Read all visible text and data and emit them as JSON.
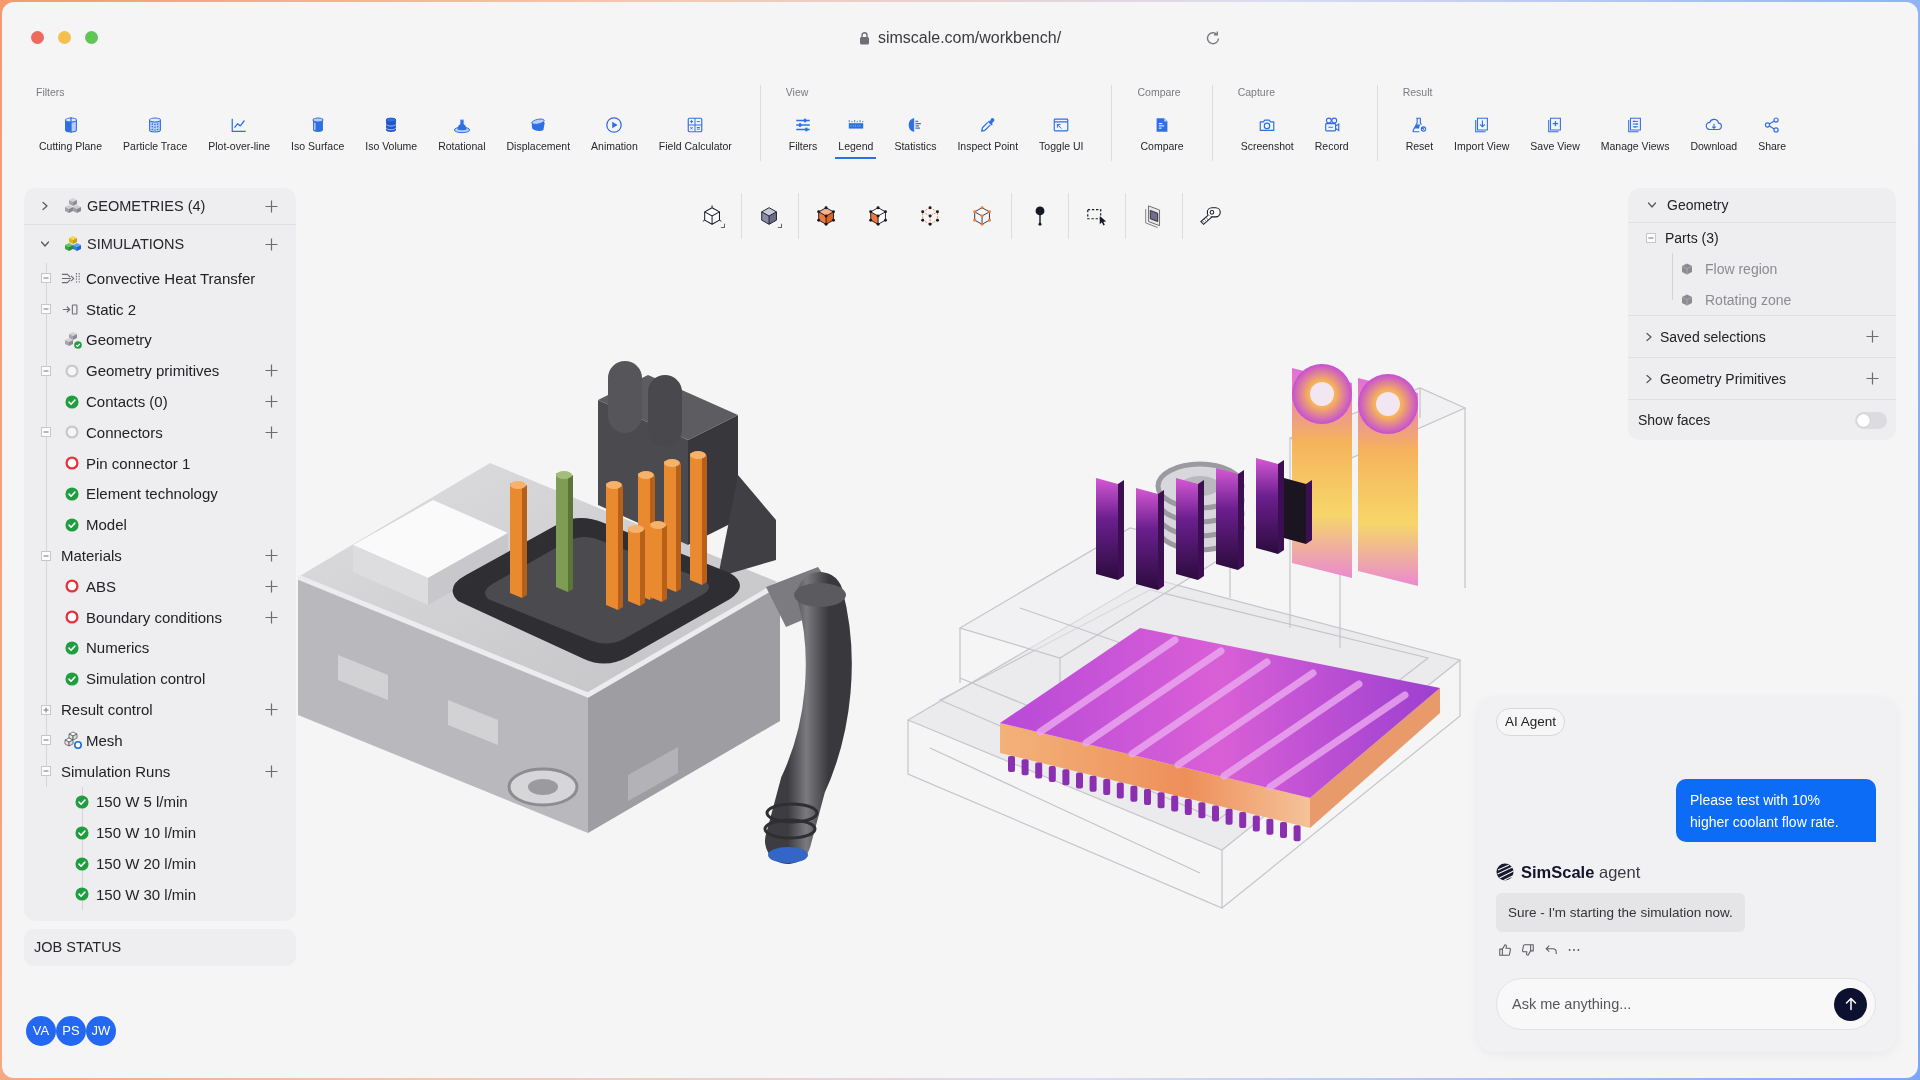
{
  "window": {
    "url": "simscale.com/workbench/"
  },
  "toolbar": {
    "groups": [
      {
        "label": "Filters",
        "items": [
          {
            "label": "Cutting Plane",
            "selected": false
          },
          {
            "label": "Particle Trace",
            "selected": false
          },
          {
            "label": "Plot-over-line",
            "selected": false
          },
          {
            "label": "Iso Surface",
            "selected": false
          },
          {
            "label": "Iso Volume",
            "selected": false
          },
          {
            "label": "Rotational",
            "selected": false
          },
          {
            "label": "Displacement",
            "selected": false
          },
          {
            "label": "Animation",
            "selected": false
          },
          {
            "label": "Field Calculator",
            "selected": false
          }
        ]
      },
      {
        "label": "View",
        "items": [
          {
            "label": "Filters",
            "selected": false
          },
          {
            "label": "Legend",
            "selected": true
          },
          {
            "label": "Statistics",
            "selected": false
          },
          {
            "label": "Inspect Point",
            "selected": false
          },
          {
            "label": "Toggle UI",
            "selected": false
          }
        ]
      },
      {
        "label": "Compare",
        "items": [
          {
            "label": "Compare",
            "selected": false
          }
        ]
      },
      {
        "label": "Capture",
        "items": [
          {
            "label": "Screenshot",
            "selected": false
          },
          {
            "label": "Record",
            "selected": false
          }
        ]
      },
      {
        "label": "Result",
        "items": [
          {
            "label": "Reset",
            "selected": false
          },
          {
            "label": "Import View",
            "selected": false
          },
          {
            "label": "Save View",
            "selected": false
          },
          {
            "label": "Manage Views",
            "selected": false
          },
          {
            "label": "Download",
            "selected": false
          },
          {
            "label": "Share",
            "selected": false
          }
        ]
      }
    ]
  },
  "sidebar": {
    "sections": [
      {
        "label": "GEOMETRIES (4)",
        "expanded": false,
        "add_button": true
      },
      {
        "label": "SIMULATIONS",
        "expanded": true,
        "add_button": true,
        "children": [
          {
            "label": "Convective Heat Transfer",
            "kind": "analysis",
            "expanded": true,
            "add_button": false
          },
          {
            "label": "Static 2",
            "kind": "step",
            "expanded": true,
            "add_button": false
          },
          {
            "label": "Geometry",
            "kind": "geometry",
            "done": true,
            "add_button": false
          },
          {
            "label": "Geometry primitives",
            "kind": "status",
            "done": false,
            "error": false,
            "expanded": true,
            "add_button": true
          },
          {
            "label": "Contacts (0)",
            "kind": "status",
            "done": true,
            "error": false,
            "add_button": true
          },
          {
            "label": "Connectors",
            "kind": "status",
            "done": false,
            "error": false,
            "expanded": true,
            "add_button": true
          },
          {
            "label": "Pin connector 1",
            "kind": "status",
            "done": false,
            "error": true,
            "add_button": false
          },
          {
            "label": "Element technology",
            "kind": "status",
            "done": true,
            "error": false,
            "add_button": false
          },
          {
            "label": "Model",
            "kind": "status",
            "done": true,
            "error": false,
            "add_button": false
          },
          {
            "label": "Materials",
            "kind": "folder",
            "expanded": true,
            "add_button": true
          },
          {
            "label": "ABS",
            "kind": "status",
            "done": false,
            "error": true,
            "add_button": true
          },
          {
            "label": "Boundary conditions",
            "kind": "status",
            "done": false,
            "error": true,
            "add_button": true
          },
          {
            "label": "Numerics",
            "kind": "status",
            "done": true,
            "error": false,
            "add_button": false
          },
          {
            "label": "Simulation control",
            "kind": "status",
            "done": true,
            "error": false,
            "add_button": false
          },
          {
            "label": "Result control",
            "kind": "folder",
            "expanded": false,
            "add_button": true
          },
          {
            "label": "Mesh",
            "kind": "mesh",
            "done": false,
            "expanded": true,
            "add_button": false
          },
          {
            "label": "Simulation Runs",
            "kind": "folder",
            "expanded": true,
            "add_button": true,
            "children": [
              {
                "label": "150 W 5 l/min",
                "kind": "status",
                "done": true,
                "error": false,
                "add_button": false
              },
              {
                "label": "150 W 10 l/min",
                "kind": "status",
                "done": true,
                "error": false,
                "add_button": false
              },
              {
                "label": "150 W 20 l/min",
                "kind": "status",
                "done": true,
                "error": false,
                "add_button": false
              },
              {
                "label": "150 W 30 l/min",
                "kind": "status",
                "done": true,
                "error": false,
                "add_button": false
              }
            ]
          }
        ]
      }
    ]
  },
  "job_status": {
    "label": "JOB STATUS"
  },
  "avatars": [
    {
      "initials": "VA"
    },
    {
      "initials": "PS"
    },
    {
      "initials": "JW"
    }
  ],
  "geometry_panel": {
    "tree": [
      {
        "label": "Geometry",
        "expanded": true,
        "add_button": false,
        "children": [
          {
            "label": "Parts (3)",
            "expanded": true,
            "children": [
              {
                "label": "Flow region"
              },
              {
                "label": "Rotating zone"
              }
            ]
          }
        ]
      },
      {
        "label": "Saved selections",
        "expanded": false,
        "add_button": true
      },
      {
        "label": "Geometry Primitives",
        "expanded": false,
        "add_button": true
      }
    ],
    "show_faces": {
      "label": "Show faces",
      "on": false
    }
  },
  "chat": {
    "label": "AI Agent",
    "messages": [
      {
        "kind": "user",
        "text": "Please test with 10% higher coolant flow rate."
      },
      {
        "kind": "agent",
        "sender": "**SimScale** agent",
        "text": "Sure - I'm starting the simulation now."
      }
    ],
    "input": {
      "placeholder": "Ask me anything..."
    }
  }
}
